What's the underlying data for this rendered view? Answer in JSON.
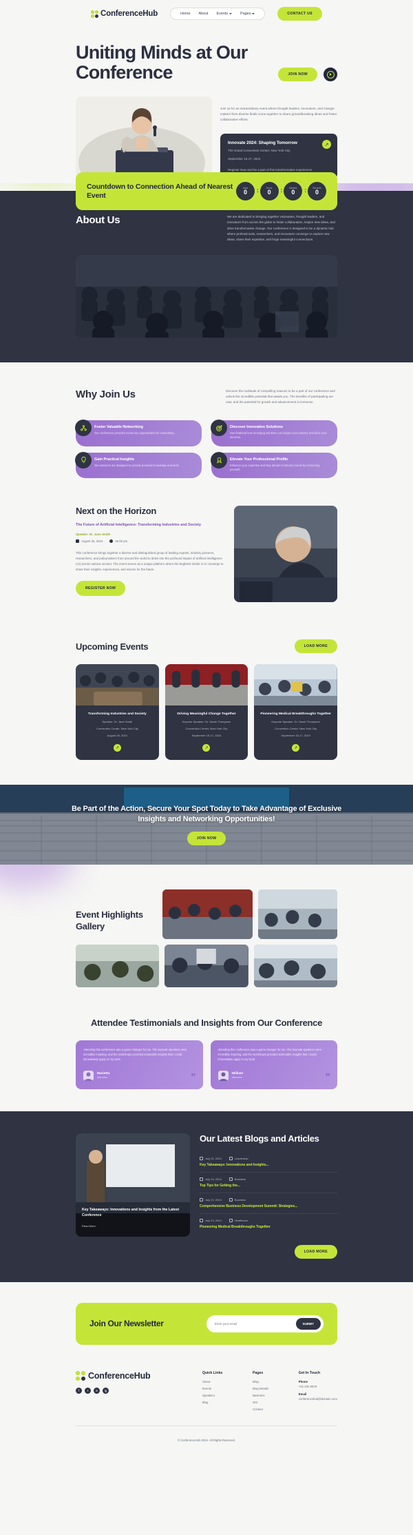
{
  "header": {
    "brand": "ConferenceHub",
    "nav": [
      {
        "label": "Home",
        "caret": false
      },
      {
        "label": "About",
        "caret": false
      },
      {
        "label": "Events",
        "caret": true
      },
      {
        "label": "Pages",
        "caret": true
      }
    ],
    "cta": "CONTACT US"
  },
  "hero": {
    "title": "Uniting Minds at Our Conference",
    "join_label": "JOIN NOW",
    "play_icon": "play-icon",
    "lead": "Join us for an extraordinary event where thought leaders, innovators, and change-makers from diverse fields come together to share groundbreaking ideas and foster collaborative efforts.",
    "event_card": {
      "title": "Innovate 2024: Shaping Tomorrow",
      "venue": "The Grand Convention Center, New York City",
      "date": "September 15-17, 2024",
      "register": "Register Now and be a part of this transformative experience!",
      "arrow": "↗"
    }
  },
  "countdown": {
    "heading": "Countdown to Connection Ahead of Nearest Event",
    "units": [
      {
        "label": "Days",
        "value": "0"
      },
      {
        "label": "Hours",
        "value": "0"
      },
      {
        "label": "Minutes",
        "value": "0"
      },
      {
        "label": "Seconds",
        "value": "0"
      }
    ]
  },
  "about": {
    "title": "About Us",
    "text": "We are dedicated to bringing together visionaries, thought leaders, and innovators from across the globe to foster collaboration, inspire new ideas, and drive transformative change. Our conference is designed to be a dynamic hub where professionals, researchers, and innovators converge to explore new ideas, share their expertise, and forge meaningful connections."
  },
  "why": {
    "title": "Why Join Us",
    "text": "Discover the multitude of compelling reasons to be a part of our conference and unlock the incredible potential that awaits you. The benefits of participating are vast, and the potential for growth and advancement is immense.",
    "features": [
      {
        "icon": "network-icon",
        "title": "Foster Valuable Networking",
        "desc": "Our conference provides numerous opportunities for networking."
      },
      {
        "icon": "target-icon",
        "title": "Discover Innovative Solutions",
        "desc": "See firsthand how emerging solutions can impact your industry and drive your success."
      },
      {
        "icon": "lightbulb-icon",
        "title": "Gain Practical Insights",
        "desc": "Our sessions are designed to provide practical knowledge and tools."
      },
      {
        "icon": "badge-icon",
        "title": "Elevate Your Professional Profile",
        "desc": "Enhance your expertise and stay ahead of industry trends by immersing yourself."
      }
    ]
  },
  "horizon": {
    "title": "Next on the Horizon",
    "subtitle": "The Future of Artificial Intelligence: Transforming Industries and Society",
    "speaker": "Speaker: Dr. Jane Smith",
    "date": "August 25, 2024",
    "time": "02:00 pm",
    "paragraph": "This conference brings together a diverse and distinguished group of leading experts, industry pioneers, researchers, and policymakers from around the world to delve into the profound impact of artificial intelligence (AI) across various sectors. The event serves as a unique platform where the brightest minds in AI converge to share their insights, experiences, and visions for the future.",
    "button": "REGISTER NOW"
  },
  "upcoming": {
    "title": "Upcoming Events",
    "load_more": "LOAD MORE",
    "events": [
      {
        "title": "Transforming Industries and Society",
        "speaker": "Speaker: Dr. Jane Smith",
        "venue": "Convention Center, New York City",
        "date": "August 25, 2024",
        "arrow": "↗"
      },
      {
        "title": "Driving Meaningful Change Together",
        "speaker": "Keynote Speaker: Dr. Sarah Thompson",
        "venue": "Convention Center, New York City",
        "date": "September 15-17, 2024",
        "arrow": "↗"
      },
      {
        "title": "Pioneering Medical Breakthroughs Together",
        "speaker": "Keynote Speaker: Dr. Sarah Thompson",
        "venue": "Convention Center, New York City",
        "date": "September 15-17, 2024",
        "arrow": "↗"
      }
    ]
  },
  "cta_banner": {
    "heading": "Be Part of the Action, Secure Your Spot Today to Take Advantage of Exclusive Insights and Networking Opportunities!",
    "button": "JOIN NOW"
  },
  "gallery": {
    "title": "Event Highlights Gallery"
  },
  "testimonials": {
    "title": "Attendee Testimonials and Insights from Our Conference",
    "items": [
      {
        "text": "Attending this conference was a game changer for me. The keynote speakers were incredibly inspiring, and the workshops provided actionable insights that I could immediately apply to my work.",
        "name": "Marietta",
        "role": "Attendee",
        "quote": "”"
      },
      {
        "text": "Attending this conference was a game changer for me. The keynote speakers were incredibly inspiring, and the workshops provided actionable insights that I could immediately apply to my work.",
        "name": "William",
        "role": "Attendee",
        "quote": "”"
      }
    ]
  },
  "blogs": {
    "title": "Our Latest Blogs and Articles",
    "feature": {
      "title": "Key Takeaways: Innovations and Insights from the Latest Conference",
      "author": "Read More"
    },
    "load_more": "LOAD MORE",
    "items": [
      {
        "date": "July 31, 2024",
        "category": "Leadership",
        "title": "Key Takeaways: Innovations and Insights..."
      },
      {
        "date": "July 24, 2024",
        "category": "Business",
        "title": "Top Tips for Getting the..."
      },
      {
        "date": "July 23, 2024",
        "category": "Business",
        "title": "Comprehensive Business Development Summit: Strategies..."
      },
      {
        "date": "July 23, 2024",
        "category": "Healthcare",
        "title": "Pioneering Medical Breakthroughs Together"
      }
    ]
  },
  "newsletter": {
    "title": "Join Our Newsletter",
    "placeholder": "Enter your email",
    "submit": "SUBMIT"
  },
  "footer": {
    "brand": "ConferenceHub",
    "socials": [
      "f",
      "t",
      "in",
      "ig"
    ],
    "columns": [
      {
        "heading": "Quick Links",
        "links": [
          "About",
          "Events",
          "Speakers",
          "Blog"
        ]
      },
      {
        "heading": "Pages",
        "links": [
          "Blog",
          "Blog Details",
          "Business",
          "404",
          "Contact"
        ]
      }
    ],
    "contact": {
      "heading": "Get In Touch",
      "phone_label": "Phone",
      "phone": "+01 234 5678",
      "email_label": "Email",
      "email": "conferencehub@domain.com"
    },
    "copyright": "© ConferenceHub 2024. All Rights Reserved."
  },
  "colors": {
    "lime": "#c4e538",
    "dark": "#2f3342",
    "purple": "#a178d6",
    "bg": "#f6f6f4"
  }
}
